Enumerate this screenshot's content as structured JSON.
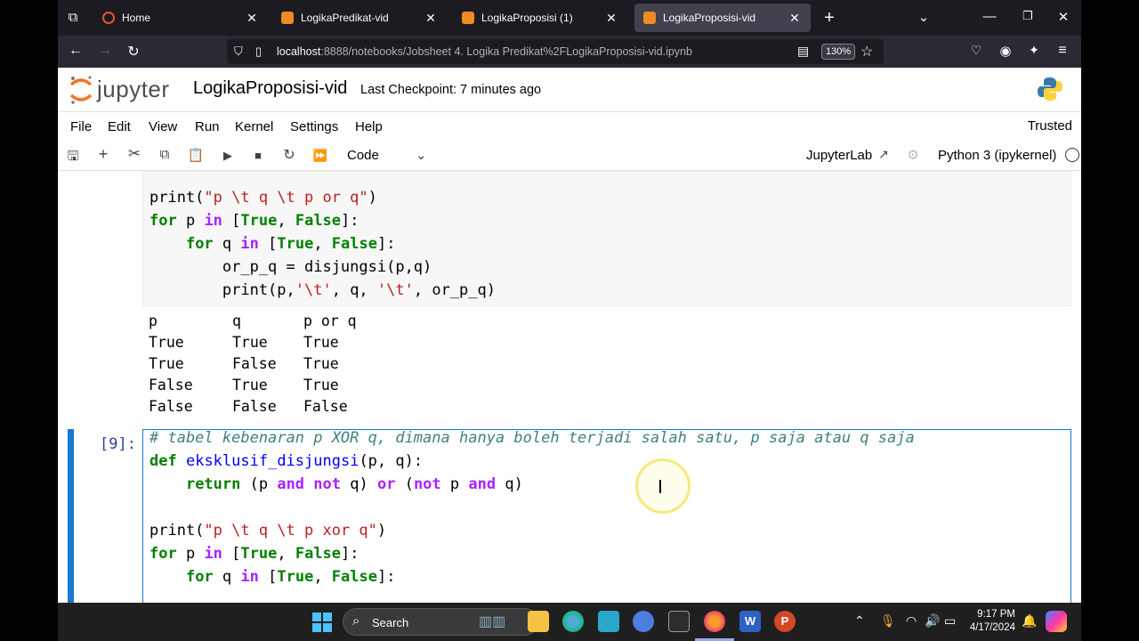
{
  "browser": {
    "tabs": [
      {
        "label": "Home",
        "active": false
      },
      {
        "label": "LogikaPredikat-vid",
        "active": false
      },
      {
        "label": "LogikaProposisi (1)",
        "active": false
      },
      {
        "label": "LogikaProposisi-vid",
        "active": true
      }
    ],
    "url_host": "localhost",
    "url_path": ":8888/notebooks/Jobsheet 4. Logika Predikat%2FLogikaProposisi-vid.ipynb",
    "zoom": "130%",
    "new_tab_icon": "plus-icon"
  },
  "jupyter": {
    "logo_text": "jupyter",
    "notebook_title": "LogikaProposisi-vid",
    "checkpoint": "Last Checkpoint: 7 minutes ago",
    "menu": [
      "File",
      "Edit",
      "View",
      "Run",
      "Kernel",
      "Settings",
      "Help"
    ],
    "trusted": "Trusted",
    "cell_type": "Code",
    "jupyterlab_link": "JupyterLab",
    "kernel_name": "Python 3 (ipykernel)"
  },
  "cells": {
    "cell1_code": [
      [
        [
          "b",
          "print("
        ],
        [
          "s",
          "\"p \\t q \\t p or q\""
        ],
        [
          "b",
          ")"
        ]
      ],
      [
        [
          "k",
          "for"
        ],
        [
          "b",
          " p "
        ],
        [
          "o",
          "in"
        ],
        [
          "b",
          " ["
        ],
        [
          "k",
          "True"
        ],
        [
          "b",
          ", "
        ],
        [
          "k",
          "False"
        ],
        [
          "b",
          "]:"
        ]
      ],
      [
        [
          "b",
          "    "
        ],
        [
          "k",
          "for"
        ],
        [
          "b",
          " q "
        ],
        [
          "o",
          "in"
        ],
        [
          "b",
          " ["
        ],
        [
          "k",
          "True"
        ],
        [
          "b",
          ", "
        ],
        [
          "k",
          "False"
        ],
        [
          "b",
          "]:"
        ]
      ],
      [
        [
          "b",
          "        or_p_q = disjungsi(p,q)"
        ]
      ],
      [
        [
          "b",
          "        print(p,"
        ],
        [
          "s",
          "'\\t'"
        ],
        [
          "b",
          ", q, "
        ],
        [
          "s",
          "'\\t'"
        ],
        [
          "b",
          ", or_p_q)"
        ]
      ]
    ],
    "cell1_output": "p\tq\tp or q\nTrue\tTrue\tTrue\nTrue\tFalse\tTrue\nFalse\tTrue\tTrue\nFalse\tFalse\tFalse",
    "cell2_prompt": "[9]:",
    "cell2_code": [
      [
        [
          "c",
          "# tabel kebenaran p XOR q, dimana hanya boleh terjadi salah satu, p saja atau q saja"
        ]
      ],
      [
        [
          "k",
          "def"
        ],
        [
          "b",
          " "
        ],
        [
          "f",
          "eksklusif_disjungsi"
        ],
        [
          "b",
          "(p, q):"
        ]
      ],
      [
        [
          "b",
          "    "
        ],
        [
          "k",
          "return"
        ],
        [
          "b",
          " (p "
        ],
        [
          "o",
          "and"
        ],
        [
          "b",
          " "
        ],
        [
          "o",
          "not"
        ],
        [
          "b",
          " q) "
        ],
        [
          "o",
          "or"
        ],
        [
          "b",
          " ("
        ],
        [
          "o",
          "not"
        ],
        [
          "b",
          " p "
        ],
        [
          "o",
          "and"
        ],
        [
          "b",
          " q)"
        ]
      ],
      [
        [
          "b",
          ""
        ]
      ],
      [
        [
          "b",
          "print("
        ],
        [
          "s",
          "\"p \\t q \\t p xor q\""
        ],
        [
          "b",
          ")"
        ]
      ],
      [
        [
          "k",
          "for"
        ],
        [
          "b",
          " p "
        ],
        [
          "o",
          "in"
        ],
        [
          "b",
          " ["
        ],
        [
          "k",
          "True"
        ],
        [
          "b",
          ", "
        ],
        [
          "k",
          "False"
        ],
        [
          "b",
          "]:"
        ]
      ],
      [
        [
          "b",
          "    "
        ],
        [
          "k",
          "for"
        ],
        [
          "b",
          " q "
        ],
        [
          "o",
          "in"
        ],
        [
          "b",
          " ["
        ],
        [
          "k",
          "True"
        ],
        [
          "b",
          ", "
        ],
        [
          "k",
          "False"
        ],
        [
          "b",
          "]:"
        ]
      ]
    ]
  },
  "taskbar": {
    "search_label": "Search",
    "time": "9:17 PM",
    "date": "4/17/2024"
  }
}
